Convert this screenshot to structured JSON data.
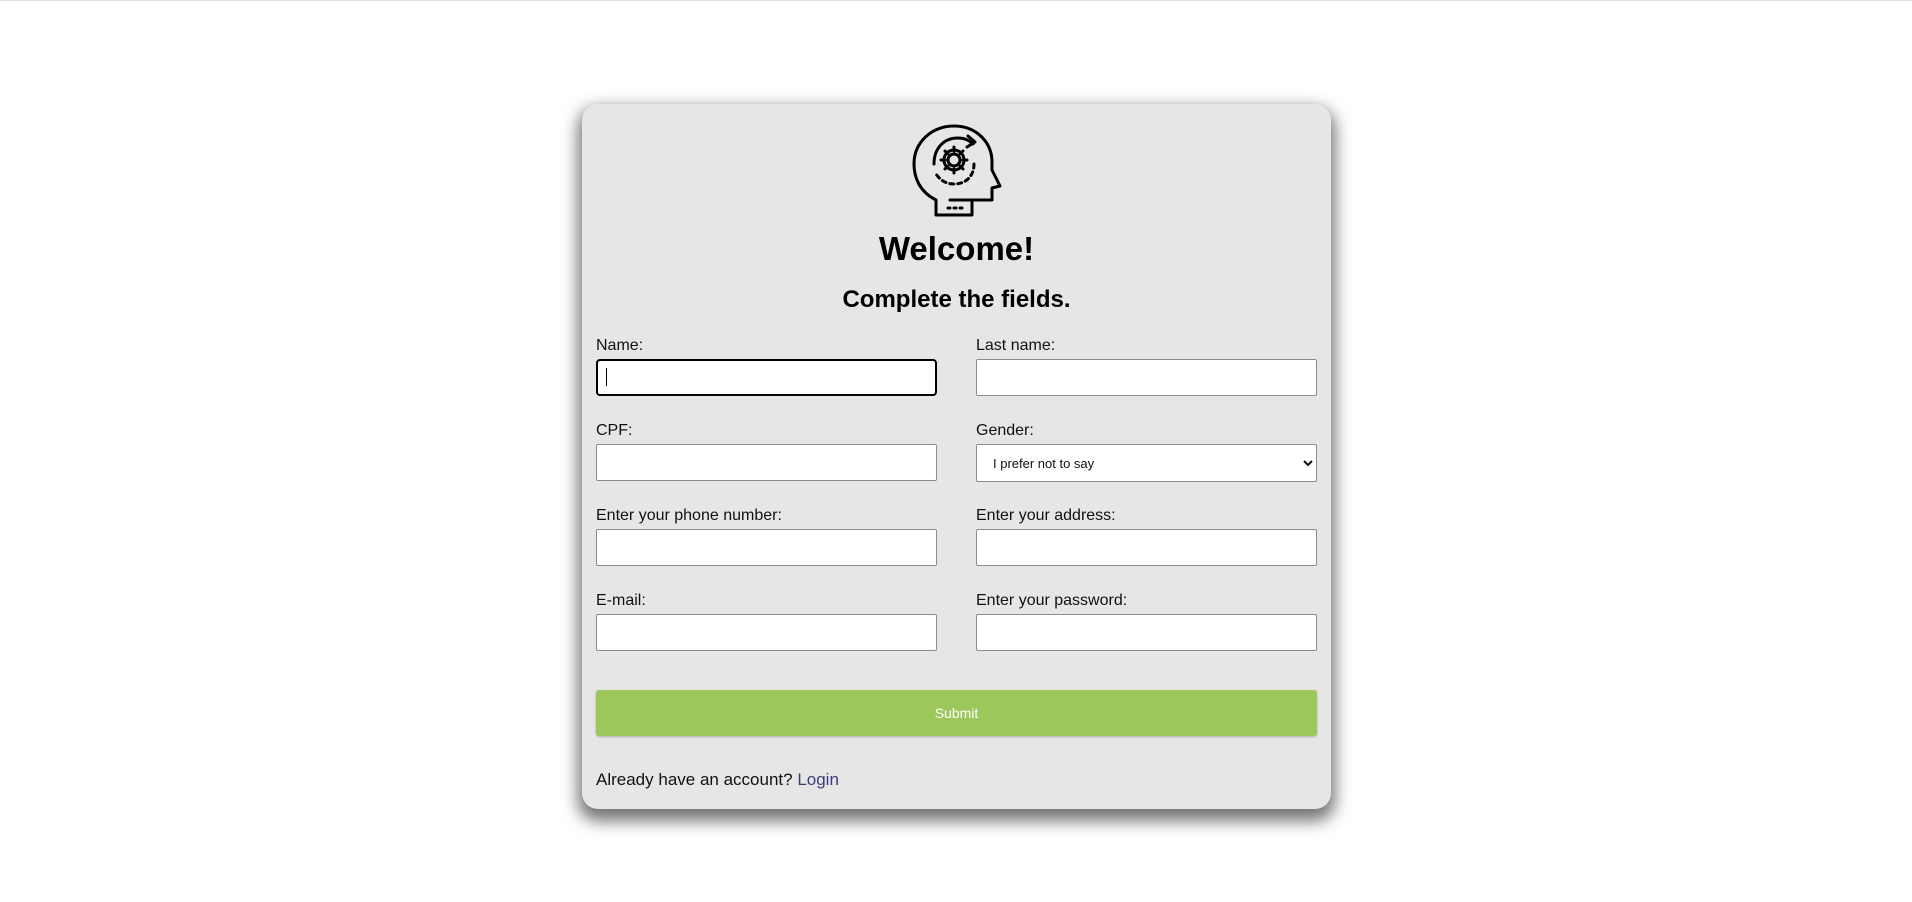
{
  "header": {
    "logo_icon": "head-with-gear-icon",
    "title": "Welcome!",
    "subtitle": "Complete the fields."
  },
  "form": {
    "name": {
      "label": "Name:",
      "value": "",
      "placeholder": ""
    },
    "last_name": {
      "label": "Last name:",
      "value": "",
      "placeholder": ""
    },
    "cpf": {
      "label": "CPF:",
      "value": "",
      "placeholder": ""
    },
    "gender": {
      "label": "Gender:",
      "selected": "I prefer not to say"
    },
    "phone": {
      "label": "Enter your phone number:",
      "value": "",
      "placeholder": ""
    },
    "address": {
      "label": "Enter your address:",
      "value": "",
      "placeholder": ""
    },
    "email": {
      "label": "E-mail:",
      "value": "",
      "placeholder": ""
    },
    "password": {
      "label": "Enter your password:",
      "value": "",
      "placeholder": ""
    },
    "submit_label": "Submit"
  },
  "footer": {
    "prompt": "Already have an account? ",
    "login_link": "Login"
  },
  "colors": {
    "card_background": "#e6e6e6",
    "submit_button": "#9cc75a",
    "link": "#3b3b7a"
  }
}
